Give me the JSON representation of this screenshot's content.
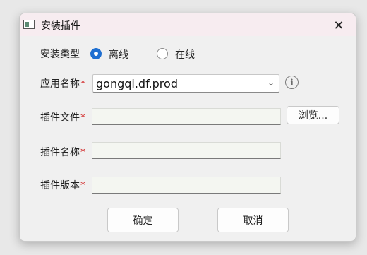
{
  "window": {
    "title": "安装插件",
    "close_glyph": "✕"
  },
  "install_type": {
    "label": "安装类型",
    "options": [
      {
        "label": "离线",
        "selected": true
      },
      {
        "label": "在线",
        "selected": false
      }
    ]
  },
  "app_name": {
    "label": "应用名称",
    "required_mark": "*",
    "value": "gongqi.df.prod",
    "dropdown_glyph": "⌄",
    "info_glyph": "i"
  },
  "plugin_file": {
    "label": "插件文件",
    "required_mark": "*",
    "value": "",
    "browse_label": "浏览..."
  },
  "plugin_name": {
    "label": "插件名称",
    "required_mark": "*",
    "value": ""
  },
  "plugin_version": {
    "label": "插件版本",
    "required_mark": "*",
    "value": ""
  },
  "buttons": {
    "ok_label": "确定",
    "cancel_label": "取消"
  },
  "colors": {
    "accent": "#1f6fd1",
    "required": "#d01818",
    "titlebar_bg": "#f7ecf0",
    "dialog_bg": "#f0f0f0"
  }
}
